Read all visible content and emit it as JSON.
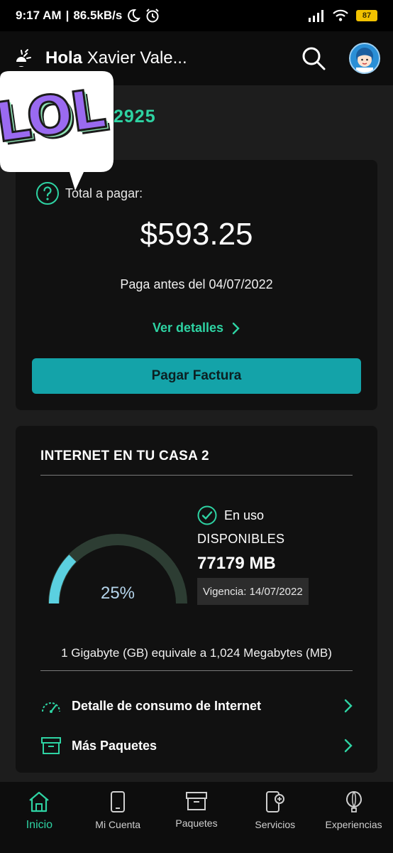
{
  "status_bar": {
    "time": "9:17 AM",
    "speed": "86.5kB/s",
    "battery": "87"
  },
  "header": {
    "greeting_bold": "Hola",
    "greeting_name": "Xavier Vale..."
  },
  "account": {
    "number_partial": "2925"
  },
  "sticker": {
    "text": "LOL"
  },
  "bill": {
    "total_label": "Total a pagar:",
    "amount": "$593.25",
    "due_text": "Paga antes del 04/07/2022",
    "details_link": "Ver detalles",
    "pay_button": "Pagar Factura"
  },
  "internet": {
    "title": "INTERNET EN TU CASA 2",
    "status": "En uso",
    "available_label": "DISPONIBLES",
    "available_value": "77179 MB",
    "validity": "Vigencia: 14/07/2022",
    "usage_percent": "25%",
    "usage_fraction": 0.25,
    "equivalence": "1 Gigabyte (GB) equivale a 1,024 Megabytes (MB)",
    "menu": [
      {
        "label": "Detalle de consumo de Internet",
        "icon": "speedometer-icon"
      },
      {
        "label": "Más Paquetes",
        "icon": "box-icon"
      }
    ]
  },
  "bottom_nav": [
    {
      "label": "Inicio",
      "icon": "home-icon",
      "active": true
    },
    {
      "label": "Mi Cuenta",
      "icon": "phone-icon",
      "active": false
    },
    {
      "label": "Paquetes",
      "icon": "box-icon",
      "active": false
    },
    {
      "label": "Servicios",
      "icon": "phone-plus-icon",
      "active": false
    },
    {
      "label": "Experiencias",
      "icon": "balloon-icon",
      "active": false
    }
  ],
  "colors": {
    "accent": "#2ed3a3",
    "button": "#14a3a9",
    "gauge_fill": "#5bd0e0",
    "gauge_track": "#2d3d33"
  }
}
